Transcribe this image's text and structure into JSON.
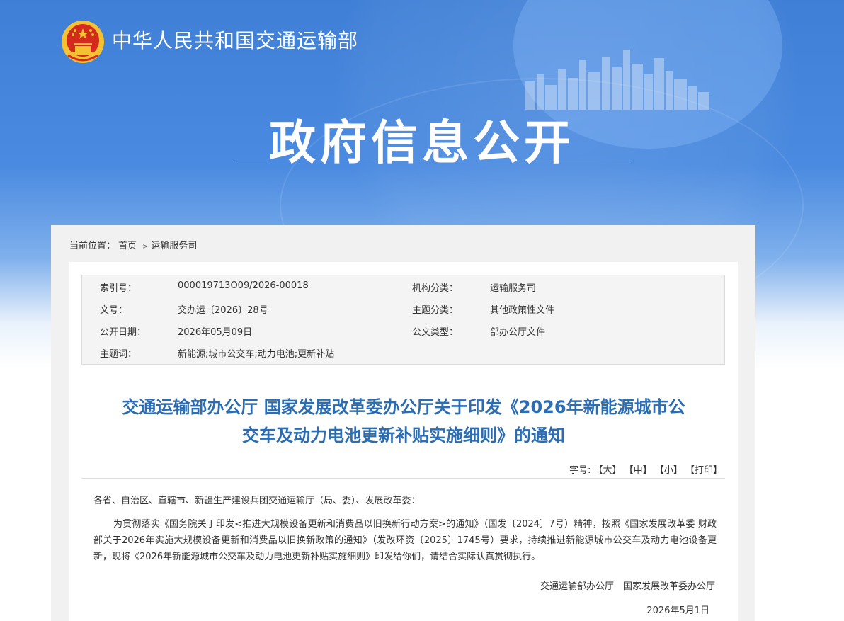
{
  "header": {
    "site_name": "中华人民共和国交通运输部",
    "section_title": "政府信息公开"
  },
  "breadcrumb": {
    "label": "当前位置：",
    "items": [
      "首页",
      "运输服务司"
    ],
    "separator": ">"
  },
  "meta": {
    "index_label": "索引号：",
    "index_value": "000019713O09/2026-00018",
    "org_label": "机构分类：",
    "org_value": "运输服务司",
    "doc_no_label": "文号：",
    "doc_no_value": "交办运〔2026〕28号",
    "topic_label": "主题分类：",
    "topic_value": "其他政策性文件",
    "date_label": "公开日期：",
    "date_value": "2026年05月09日",
    "type_label": "公文类型：",
    "type_value": "部办公厅文件",
    "keywords_label": "主题词：",
    "keywords_value": "新能源;城市公交车;动力电池;更新补贴"
  },
  "document": {
    "title_line1": "交通运输部办公厅 国家发展改革委办公厅关于印发《2026年新能源城市公",
    "title_line2": "交车及动力电池更新补贴实施细则》的通知",
    "font_size_label": "字号:",
    "font_large": "【大】",
    "font_medium": "【中】",
    "font_small": "【小】",
    "print": "【打印】",
    "greeting": "各省、自治区、直辖市、新疆生产建设兵团交通运输厅（局、委）、发展改革委：",
    "paragraph": "为贯彻落实《国务院关于印发<推进大规模设备更新和消费品以旧换新行动方案>的通知》（国发〔2024〕7号）精神，按照《国家发展改革委 财政部关于2026年实施大规模设备更新和消费品以旧换新政策的通知》（发改环资〔2025〕1745号）要求，持续推进新能源城市公交车及动力电池设备更新，现将《2026年新能源城市公交车及动力电池更新补贴实施细则》印发给你们，请结合实际认真贯彻执行。",
    "signatory": "交通运输部办公厅　国家发展改革委办公厅",
    "date": "2026年5月1日"
  },
  "colors": {
    "banner_blue": "#4a8ae0",
    "title_blue": "#2b6db3",
    "emblem_red": "#d42a1e",
    "emblem_gold": "#f3c131"
  }
}
